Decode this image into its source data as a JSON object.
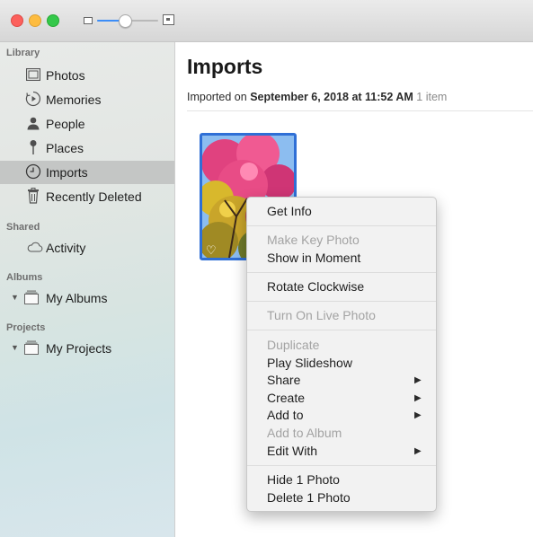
{
  "toolbar": {
    "zoom_level": 0.45,
    "icons": [
      "small-thumbnail-icon",
      "large-thumbnail-icon"
    ]
  },
  "sidebar": {
    "sections": {
      "library": "Library",
      "shared": "Shared",
      "albums": "Albums",
      "projects": "Projects"
    },
    "library_items": [
      {
        "label": "Photos",
        "icon": "photos-icon"
      },
      {
        "label": "Memories",
        "icon": "memories-icon"
      },
      {
        "label": "People",
        "icon": "person-icon"
      },
      {
        "label": "Places",
        "icon": "pin-icon"
      },
      {
        "label": "Imports",
        "icon": "clock-icon",
        "selected": true
      },
      {
        "label": "Recently Deleted",
        "icon": "trash-icon"
      }
    ],
    "shared_items": [
      {
        "label": "Activity",
        "icon": "cloud-icon"
      }
    ],
    "album_items": [
      {
        "label": "My Albums",
        "icon": "album-stack-icon"
      }
    ],
    "project_items": [
      {
        "label": "My Projects",
        "icon": "album-stack-icon"
      }
    ]
  },
  "main": {
    "title": "Imports",
    "import_prefix": "Imported on",
    "import_date": "September 6, 2018 at 11:52 AM",
    "item_count": "1 item"
  },
  "context_menu": {
    "groups": [
      [
        {
          "label": "Get Info",
          "enabled": true
        }
      ],
      [
        {
          "label": "Make Key Photo",
          "enabled": false
        },
        {
          "label": "Show in Moment",
          "enabled": true
        }
      ],
      [
        {
          "label": "Rotate Clockwise",
          "enabled": true
        }
      ],
      [
        {
          "label": "Turn On Live Photo",
          "enabled": false
        }
      ],
      [
        {
          "label": "Duplicate",
          "enabled": false
        },
        {
          "label": "Play Slideshow",
          "enabled": true
        },
        {
          "label": "Share",
          "enabled": true,
          "submenu": true
        },
        {
          "label": "Create",
          "enabled": true,
          "submenu": true
        },
        {
          "label": "Add to",
          "enabled": true,
          "submenu": true
        },
        {
          "label": "Add to Album",
          "enabled": false
        },
        {
          "label": "Edit With",
          "enabled": true,
          "submenu": true
        }
      ],
      [
        {
          "label": "Hide 1 Photo",
          "enabled": true
        },
        {
          "label": "Delete 1 Photo",
          "enabled": true
        }
      ]
    ]
  },
  "colors": {
    "accent": "#3c8df7",
    "selection_border": "#2f6fd6",
    "sidebar_selected": "#c4c6c5",
    "disabled_text": "#a3a3a3"
  }
}
